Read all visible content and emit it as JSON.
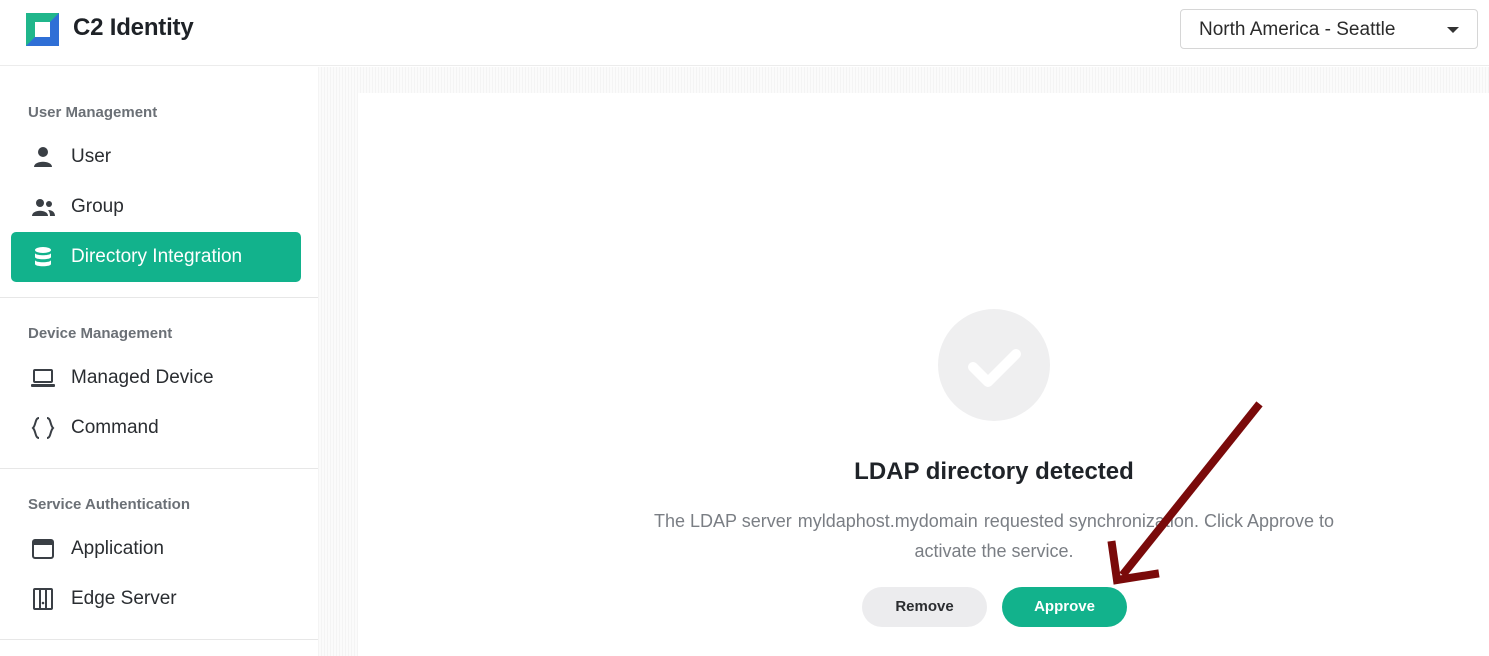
{
  "header": {
    "app_title": "C2 Identity",
    "region_selected": "North America - Seattle"
  },
  "sidebar": {
    "sections": [
      {
        "title": "User Management",
        "items": [
          {
            "label": "User",
            "icon": "user-icon"
          },
          {
            "label": "Group",
            "icon": "group-icon"
          },
          {
            "label": "Directory Integration",
            "icon": "database-icon",
            "active": true
          }
        ]
      },
      {
        "title": "Device Management",
        "items": [
          {
            "label": "Managed Device",
            "icon": "laptop-icon"
          },
          {
            "label": "Command",
            "icon": "braces-icon"
          }
        ]
      },
      {
        "title": "Service Authentication",
        "items": [
          {
            "label": "Application",
            "icon": "app-window-icon"
          },
          {
            "label": "Edge Server",
            "icon": "server-icon"
          }
        ]
      }
    ]
  },
  "main": {
    "status_icon": "checkmark-icon",
    "headline": "LDAP directory detected",
    "description_prefix": "The LDAP server",
    "description_host": "myldaphost.mydomain",
    "description_line1_suffix": "requested synchronization. Click Approve to",
    "description_line2": "activate the service.",
    "remove_label": "Remove",
    "approve_label": "Approve"
  },
  "colors": {
    "accent": "#12b28c",
    "annotation_arrow": "#7a0a0a"
  }
}
